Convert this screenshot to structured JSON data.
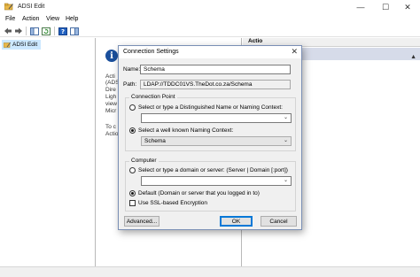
{
  "window": {
    "title": "ADSI Edit",
    "minimize_glyph": "—",
    "maximize_glyph": "☐",
    "close_glyph": "✕"
  },
  "menu": [
    "File",
    "Action",
    "View",
    "Help"
  ],
  "toolbar": {
    "icons": [
      "back-arrow-icon",
      "forward-arrow-icon",
      "console-tree-icon",
      "refresh-icon",
      "help-icon",
      "show-hide-pane-icon"
    ]
  },
  "tree": {
    "root_label": "ADSI Edit"
  },
  "background_pane": {
    "info_glyph": "i",
    "lines": [
      "Acti",
      "(ADS",
      "Dire",
      "Ligh",
      "view",
      "Micr"
    ],
    "lines2": [
      "To c",
      "Actio"
    ]
  },
  "actions_pane": {
    "header": "Actio",
    "arrow_glyph": "▲"
  },
  "dialog": {
    "title": "Connection Settings",
    "close_glyph": "✕",
    "name_label": "Name:",
    "name_value": "Schema",
    "path_label": "Path:",
    "path_value": "LDAP://TDDC01VS.TheDot.co.za/Schema",
    "connection_point": {
      "group_title": "Connection Point",
      "dn_option": "Select or type a Distinguished Name or Naming Context:",
      "dn_value": "",
      "wk_option": "Select a well known Naming Context:",
      "wk_value": "Schema"
    },
    "computer": {
      "group_title": "Computer",
      "server_option": "Select or type a domain or server: (Server | Domain [:port])",
      "server_value": "",
      "default_option": "Default (Domain or server that you logged in to)",
      "ssl_label": "Use SSL-based Encryption"
    },
    "buttons": {
      "advanced": "Advanced...",
      "ok": "OK",
      "cancel": "Cancel"
    },
    "dropdown_glyph": "⌄"
  },
  "colors": {
    "selection": "#cce8ff",
    "info_icon": "#1a4f9c",
    "default_button": "#0078d7"
  }
}
